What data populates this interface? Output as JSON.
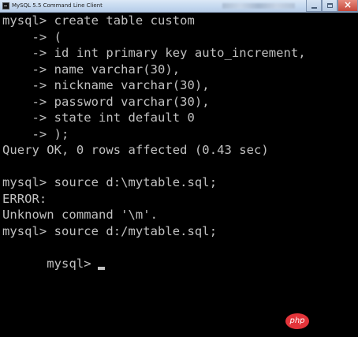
{
  "window": {
    "title": "MySQL 5.5 Command Line Client",
    "controls": {
      "minimize": "",
      "maximize": "",
      "close": ""
    }
  },
  "console": {
    "lines": [
      "mysql> create table custom",
      "    -> (",
      "    -> id int primary key auto_increment,",
      "    -> name varchar(30),",
      "    -> nickname varchar(30),",
      "    -> password varchar(30),",
      "    -> state int default 0",
      "    -> );",
      "Query OK, 0 rows affected (0.43 sec)",
      "",
      "mysql> source d:\\mytable.sql;",
      "ERROR:",
      "Unknown command '\\m'.",
      "mysql> source d:/mytable.sql;",
      "mysql>"
    ]
  },
  "watermark": {
    "text": "php"
  },
  "colors": {
    "console_background": "#000000",
    "console_text": "#c0c0c0",
    "watermark": "#e3343a"
  }
}
